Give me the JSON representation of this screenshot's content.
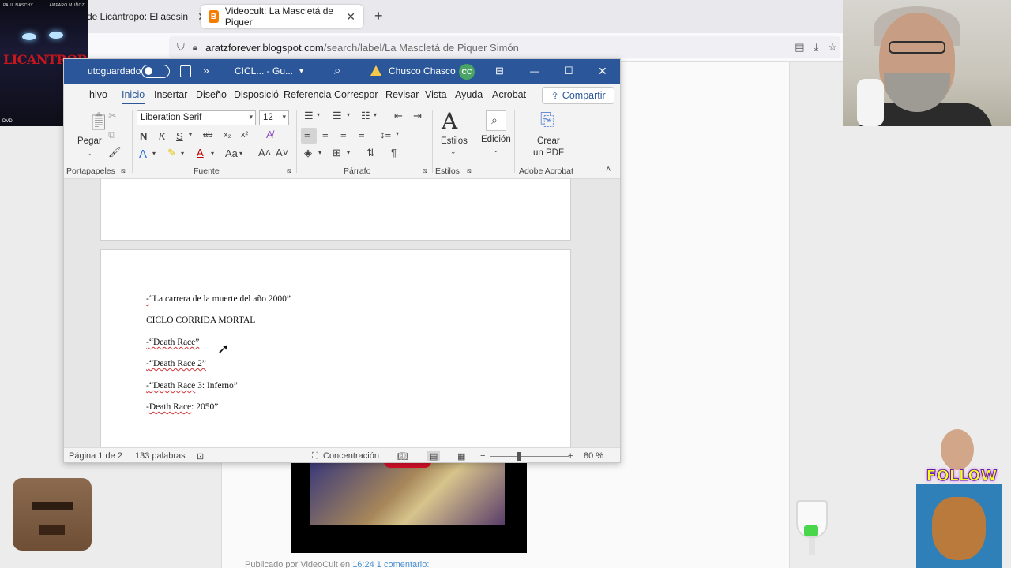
{
  "browser": {
    "tabs": [
      {
        "label": "de Licántropo: El asesin",
        "close": "✕"
      },
      {
        "label": "Videocult: La Mascletá de Piquer",
        "close": "✕",
        "favicon": "B"
      }
    ],
    "new_tab": "+",
    "url_host": "aratzforever.blogspot.com",
    "url_path": "/search/label/La Mascletá de Piquer Simón"
  },
  "overlays": {
    "poster_credits_left": "PAUL NASCHY",
    "poster_credits_right": "AMPARO MUÑOZ",
    "poster_title": "LICANTROPO",
    "poster_dvd": "DVD",
    "follow_text": "FOLLOW ME"
  },
  "word": {
    "titlebar": {
      "autosave": "utoguardado",
      "more": "»",
      "doc_name": "CICL... - Gu...",
      "user_name": "Chusco Chasco",
      "user_initials": "CC",
      "minimize": "—",
      "maximize": "☐",
      "close": "✕"
    },
    "tabs": [
      "hivo",
      "Inicio",
      "Insertar",
      "Diseño",
      "Disposició",
      "Referencia",
      "Correspor",
      "Revisar",
      "Vista",
      "Ayuda",
      "Acrobat"
    ],
    "share_label": "Compartir",
    "ribbon": {
      "paste_label": "Pegar",
      "font_name": "Liberation Serif",
      "font_size": "12",
      "bold": "N",
      "italic": "K",
      "underline": "S",
      "strike": "ab",
      "sub": "x₂",
      "sup": "x²",
      "styles_label": "Estilos",
      "editing_label": "Edición",
      "pdf_label_1": "Crear",
      "pdf_label_2": "un PDF",
      "groups": [
        "Portapapeles",
        "Fuente",
        "Párrafo",
        "Estilos",
        "Adobe Acrobat"
      ]
    },
    "document": {
      "line1_dash": "-",
      "line1_text": "“La carrera de la muerte del año 2000”",
      "line2": "CICLO CORRIDA MORTAL",
      "line3_dash": "-",
      "line3_text": "“Death Race”",
      "line4_dash": "-",
      "line4_text": "“Death Race 2”",
      "line5_dash": "-",
      "line5_text_a": "“Death Race",
      "line5_text_b": " 3: Inferno”",
      "line6_dash": "-",
      "line6_text_a": "Death Race",
      "line6_text_b": ": 2050”"
    },
    "status": {
      "page": "Página 1 de 2",
      "words": "133 palabras",
      "focus": "Concentración",
      "zoom_minus": "−",
      "zoom_plus": "+",
      "zoom": "80 %",
      "zoom_level": 0.36
    }
  },
  "webpage": {
    "footer_prefix": "Publicado por VideoCult en",
    "footer_time": "16:24",
    "footer_comments": "1 comentario:"
  }
}
